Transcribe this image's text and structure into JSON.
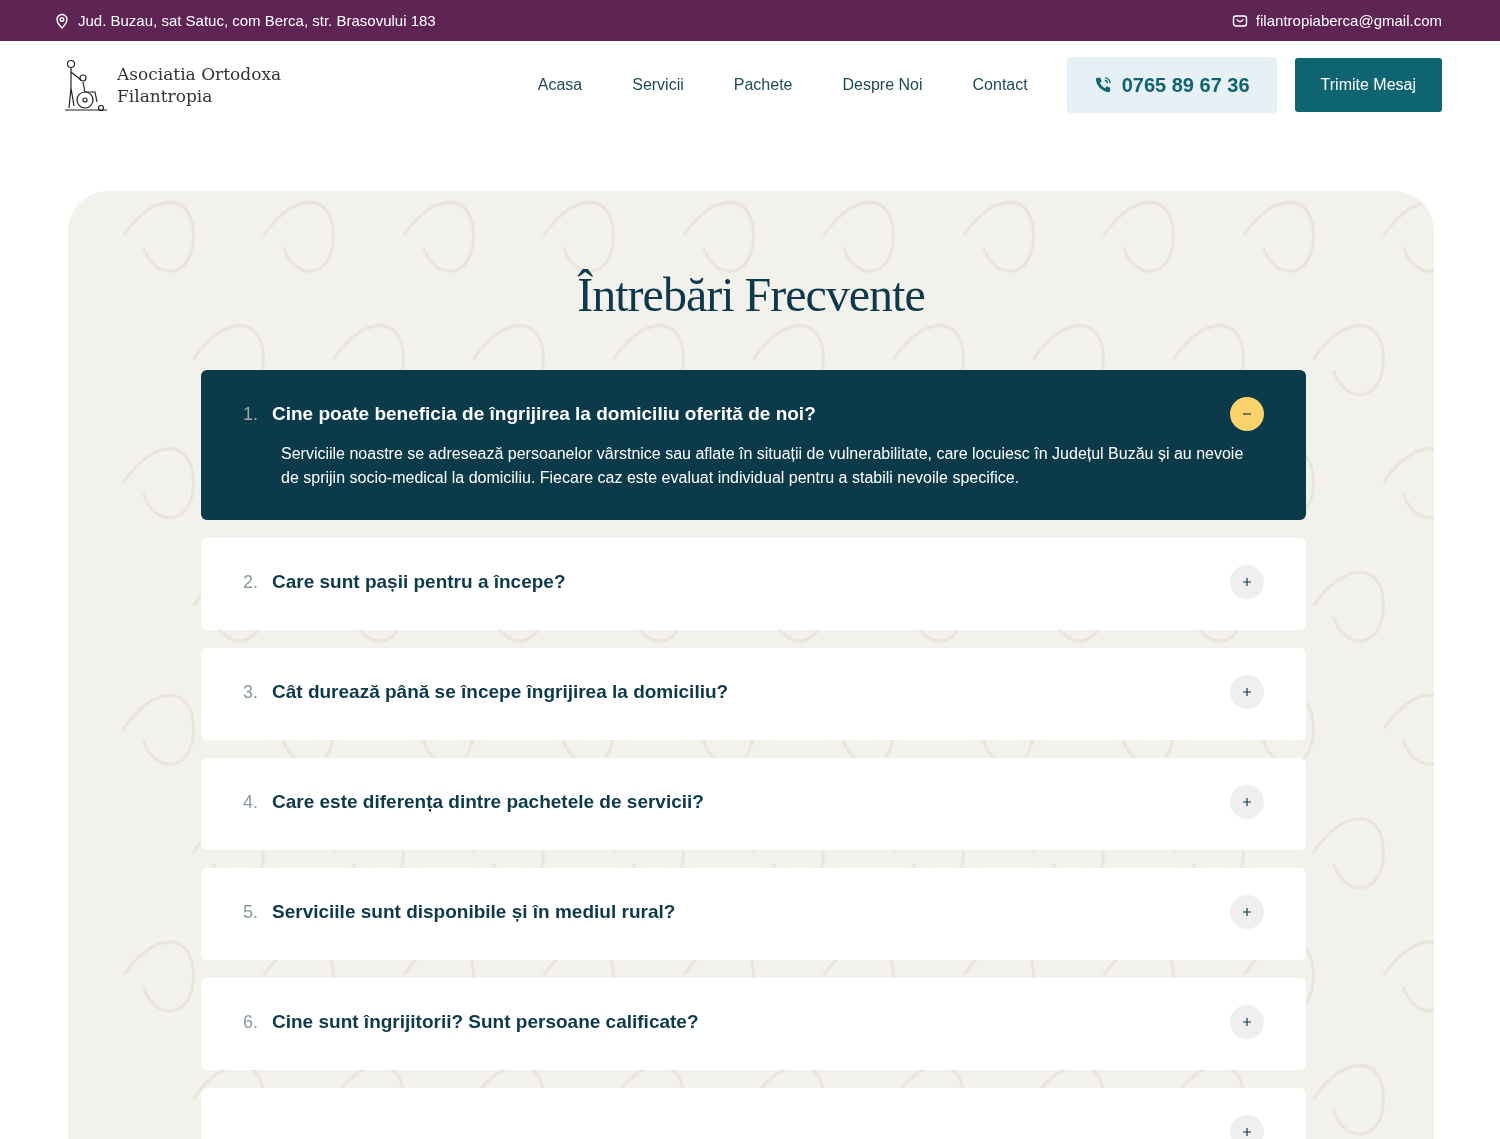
{
  "top_bar": {
    "address": "Jud. Buzau, sat Satuc, com Berca, str. Brasovului 183",
    "email": "filantropiaberca@gmail.com"
  },
  "header": {
    "logo_text": [
      "Asociatia Ortodoxa",
      "Filantropia"
    ],
    "nav": [
      "Acasa",
      "Servicii",
      "Pachete",
      "Despre Noi",
      "Contact"
    ],
    "phone": "0765 89 67 36",
    "cta": "Trimite Mesaj"
  },
  "faq": {
    "title": "Întrebări Frecvente",
    "items": [
      {
        "number": "1.",
        "question": "Cine poate beneficia de îngrijirea la domiciliu oferită de noi?",
        "answer": "Serviciile noastre se adresează persoanelor vârstnice sau aflate în situații de vulnerabilitate, care locuiesc în Județul Buzău și au nevoie de sprijin socio-medical la domiciliu. Fiecare caz este evaluat individual pentru a stabili nevoile specifice.",
        "expanded": true
      },
      {
        "number": "2.",
        "question": "Care sunt pașii pentru a începe?",
        "expanded": false
      },
      {
        "number": "3.",
        "question": "Cât durează până se începe îngrijirea la domiciliu?",
        "expanded": false
      },
      {
        "number": "4.",
        "question": "Care este diferența dintre pachetele de servicii?",
        "expanded": false
      },
      {
        "number": "5.",
        "question": "Serviciile sunt disponibile și în mediul rural?",
        "expanded": false
      },
      {
        "number": "6.",
        "question": "Cine sunt îngrijitorii? Sunt persoane calificate?",
        "expanded": false
      },
      {
        "expanded": false
      }
    ]
  }
}
